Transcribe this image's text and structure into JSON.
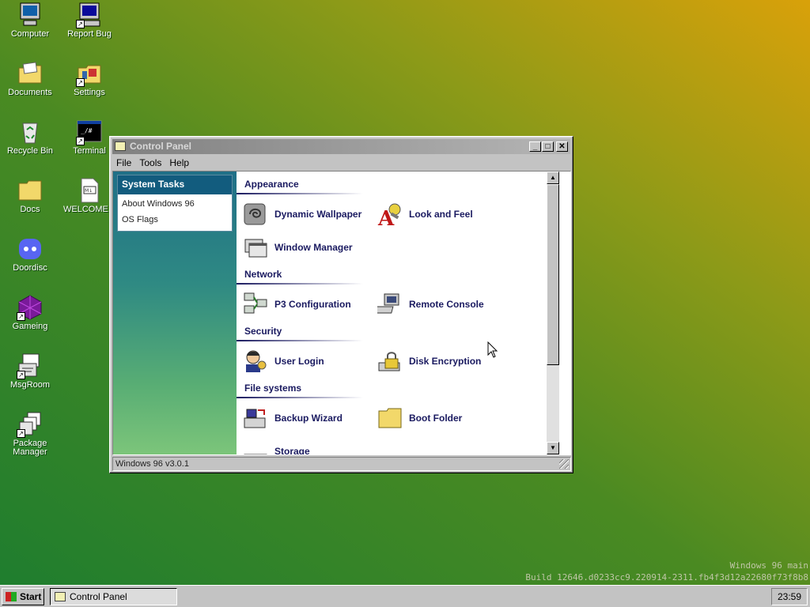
{
  "desktop": {
    "icons": [
      {
        "label": "Computer",
        "icon": "computer-icon"
      },
      {
        "label": "Report Bug",
        "icon": "report-bug-icon",
        "shortcut": true
      },
      {
        "label": "Documents",
        "icon": "documents-folder-icon"
      },
      {
        "label": "Settings",
        "icon": "settings-icon",
        "shortcut": true
      },
      {
        "label": "Recycle Bin",
        "icon": "recycle-bin-icon"
      },
      {
        "label": "Terminal",
        "icon": "terminal-icon",
        "shortcut": true
      },
      {
        "label": "Docs",
        "icon": "folder-icon"
      },
      {
        "label": "WELCOME...",
        "icon": "markdown-file-icon"
      },
      {
        "label": "Doordisc",
        "icon": "doordisc-icon"
      },
      {
        "label": "Gameing",
        "icon": "gameing-icon",
        "shortcut": true
      },
      {
        "label": "MsgRoom",
        "icon": "msgroom-icon",
        "shortcut": true
      },
      {
        "label": "Package Manager",
        "icon": "package-manager-icon",
        "shortcut": true
      }
    ],
    "terminal_glyph": "_/#",
    "welcome_glyph": "M↓",
    "watermark": {
      "line1": "Windows 96 main",
      "line2": "Build 12646.d0233cc9.220914-2311.fb4f3d12a22680f73f8b8"
    }
  },
  "window": {
    "title": "Control Panel",
    "controls": {
      "minimize": "_",
      "maximize": "□",
      "close": "✕"
    },
    "menu": [
      "File",
      "Tools",
      "Help"
    ],
    "sidebar": {
      "header": "System Tasks",
      "items": [
        "About Windows 96",
        "OS Flags"
      ]
    },
    "categories": [
      {
        "name": "Appearance",
        "items": [
          {
            "label": "Dynamic Wallpaper",
            "icon": "dynamic-wallpaper-icon"
          },
          {
            "label": "Look and Feel",
            "icon": "look-and-feel-icon"
          },
          {
            "label": "Window Manager",
            "icon": "window-manager-icon"
          }
        ]
      },
      {
        "name": "Network",
        "items": [
          {
            "label": "P3 Configuration",
            "icon": "p3-configuration-icon"
          },
          {
            "label": "Remote Console",
            "icon": "remote-console-icon"
          }
        ]
      },
      {
        "name": "Security",
        "items": [
          {
            "label": "User Login",
            "icon": "user-login-icon"
          },
          {
            "label": "Disk Encryption",
            "icon": "disk-encryption-icon"
          }
        ]
      },
      {
        "name": "File systems",
        "items": [
          {
            "label": "Backup Wizard",
            "icon": "backup-wizard-icon"
          },
          {
            "label": "Boot Folder",
            "icon": "boot-folder-icon"
          },
          {
            "label": "Storage",
            "icon": "storage-icon"
          }
        ]
      }
    ],
    "status": "Windows 96 v3.0.1",
    "scroll_up": "▲",
    "scroll_down": "▼"
  },
  "taskbar": {
    "start_label": "Start",
    "task_label": "Control Panel",
    "clock": "23:59"
  },
  "colors": {
    "accent": "#125c7e",
    "item_text": "#1a1a60",
    "desktop_gradient": [
      "#d9a10a",
      "#1d7d2f"
    ]
  }
}
